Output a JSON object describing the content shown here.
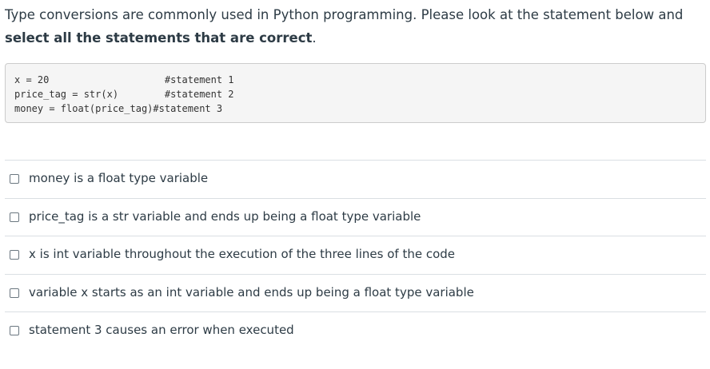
{
  "question": {
    "text_before": "Type conversions are commonly used in Python programming. Please look at the statement below and ",
    "text_bold": "select all the statements that are correct",
    "text_after": "."
  },
  "code": {
    "lines": [
      "x = 20                    #statement 1",
      "price_tag = str(x)        #statement 2",
      "money = float(price_tag)#statement 3"
    ]
  },
  "answers": [
    {
      "label": "money is a float type variable",
      "checked": false
    },
    {
      "label": "price_tag is a str variable and ends up being a float type variable",
      "checked": false
    },
    {
      "label": "x is int variable throughout the execution of the three lines of the code",
      "checked": false
    },
    {
      "label": "variable x starts as an int variable and ends up being a float type variable",
      "checked": false
    },
    {
      "label": "statement 3 causes an error when executed",
      "checked": false
    }
  ]
}
